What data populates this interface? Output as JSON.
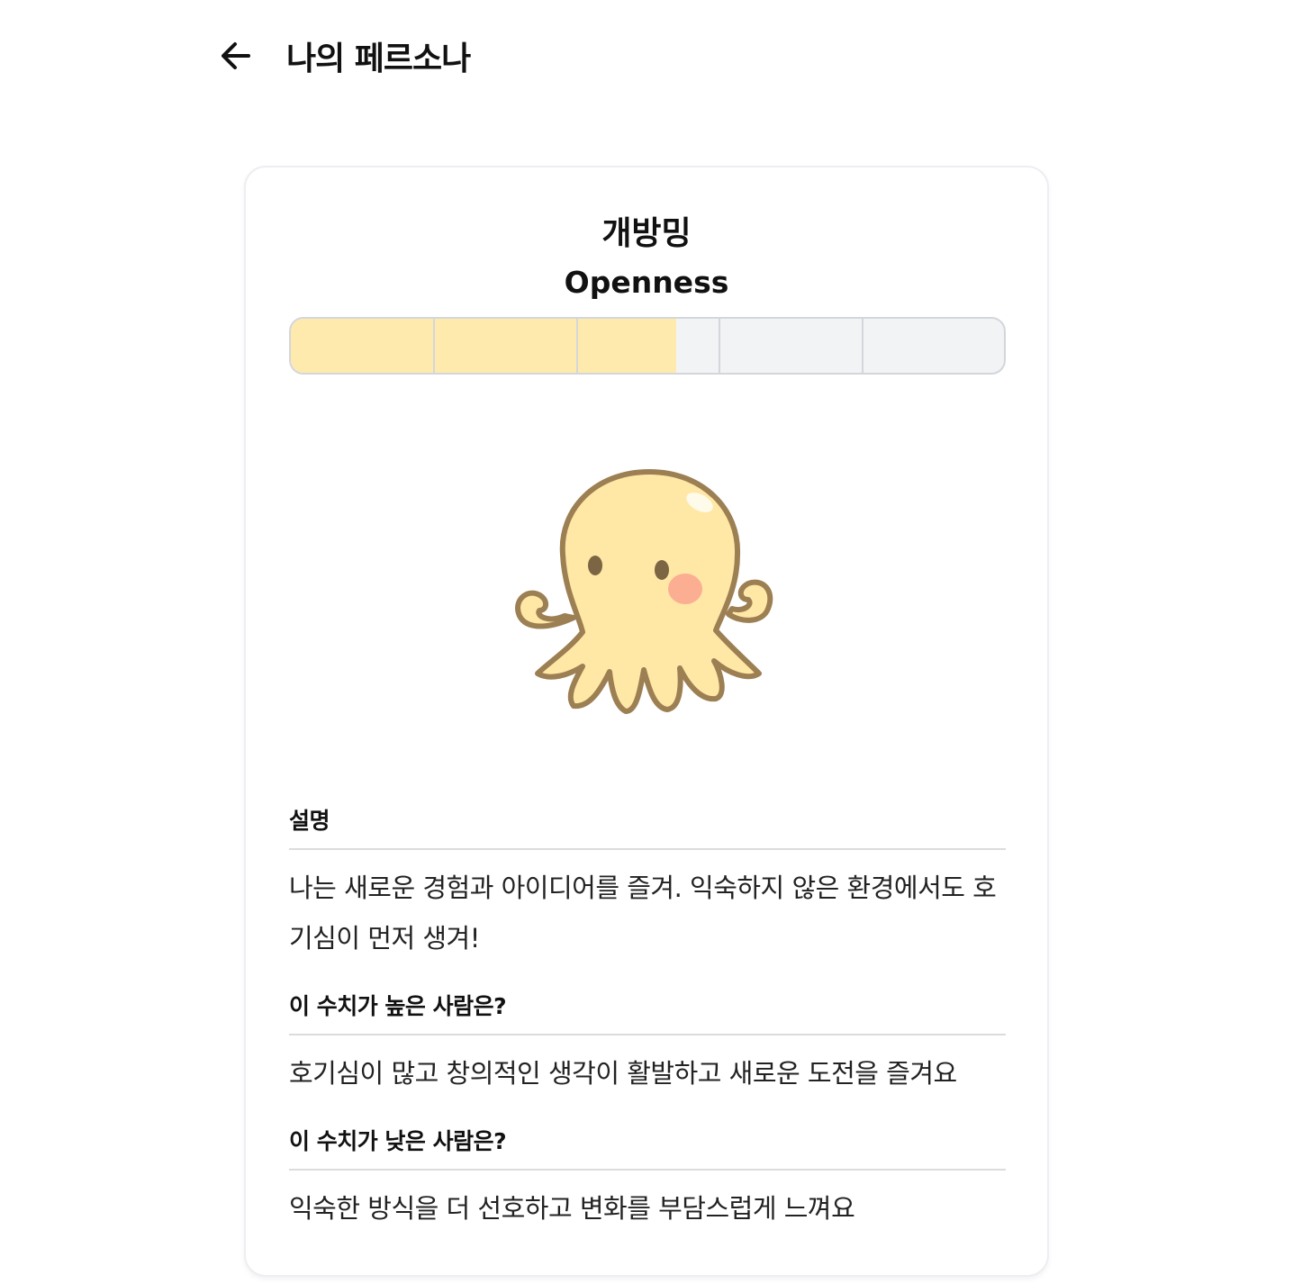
{
  "header": {
    "back_icon": "arrow-left-icon",
    "title": "나의 페르소나"
  },
  "persona": {
    "name": "개방밍",
    "trait": "Openness",
    "illustration": "octopus-character",
    "score_fraction": 0.54,
    "segments": 5,
    "colors": {
      "fill": "#ffeaad",
      "empty": "#f2f3f5",
      "octopus_body": "#ffe7a6",
      "octopus_outline": "#9c7f52",
      "cheek": "#fbae92"
    }
  },
  "sections": {
    "description": {
      "title": "설명",
      "body": "나는 새로운 경험과 아이디어를 즐겨. 익숙하지 않은 환경에서도 호기심이 먼저 생겨!"
    },
    "high": {
      "title": "이 수치가 높은 사람은?",
      "body": "호기심이 많고 창의적인 생각이 활발하고 새로운 도전을 즐겨요"
    },
    "low": {
      "title": "이 수치가 낮은 사람은?",
      "body": "익숙한 방식을 더 선호하고 변화를 부담스럽게 느껴요"
    }
  }
}
